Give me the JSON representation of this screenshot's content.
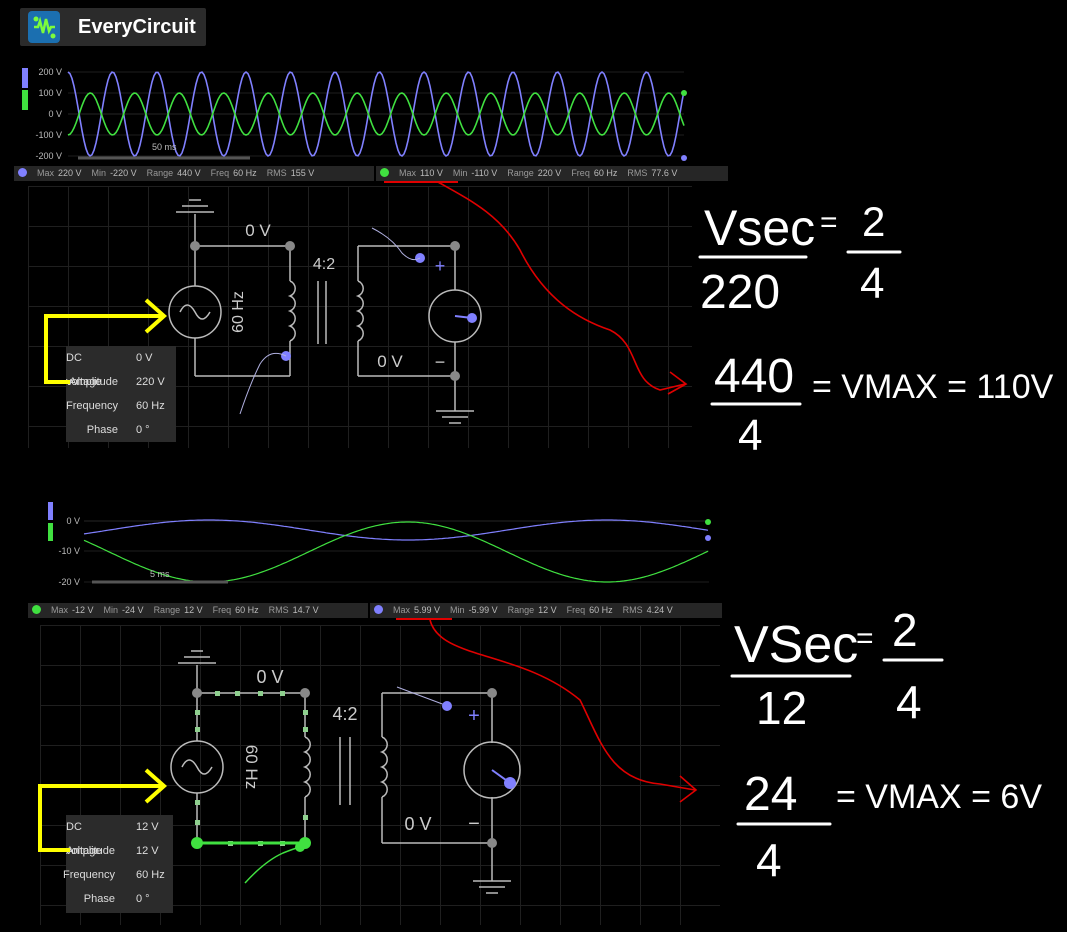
{
  "app": {
    "title": "EveryCircuit"
  },
  "colors": {
    "series_a": "#8080ff",
    "series_b": "#40e040",
    "annotation_red": "#e00000",
    "annotation_yellow": "#ffff00",
    "handwriting": "#ffffff"
  },
  "scope1": {
    "ticks": [
      "200 V",
      "100 V",
      "0 V",
      "-100 V",
      "-200 V"
    ],
    "timescale": "50 ms",
    "stats_a": {
      "max_label": "Max",
      "max": "220 V",
      "min_label": "Min",
      "min": "-220 V",
      "range_label": "Range",
      "range": "440 V",
      "freq_label": "Freq",
      "freq": "60 Hz",
      "rms_label": "RMS",
      "rms": "155 V"
    },
    "stats_b": {
      "max_label": "Max",
      "max": "110 V",
      "min_label": "Min",
      "min": "-110 V",
      "range_label": "Range",
      "range": "220 V",
      "freq_label": "Freq",
      "freq": "60 Hz",
      "rms_label": "RMS",
      "rms": "77.6 V"
    }
  },
  "circuit1": {
    "node_top": "0 V",
    "node_bottom": "0 V",
    "ratio": "4:2",
    "source_freq": "60 Hz",
    "plus": "+",
    "minus": "−",
    "params": [
      {
        "key": "DC voltage",
        "value": "0 V"
      },
      {
        "key": "Amplitude",
        "value": "220 V"
      },
      {
        "key": "Frequency",
        "value": "60 Hz"
      },
      {
        "key": "Phase",
        "value": "0 °"
      }
    ]
  },
  "scope2": {
    "ticks": [
      "0 V",
      "-10 V",
      "-20 V"
    ],
    "timescale": "5 ms",
    "stats_a": {
      "max_label": "Max",
      "max": "-12 V",
      "min_label": "Min",
      "min": "-24 V",
      "range_label": "Range",
      "range": "12 V",
      "freq_label": "Freq",
      "freq": "60 Hz",
      "rms_label": "RMS",
      "rms": "14.7 V"
    },
    "stats_b": {
      "max_label": "Max",
      "max": "5.99 V",
      "min_label": "Min",
      "min": "-5.99 V",
      "range_label": "Range",
      "range": "12 V",
      "freq_label": "Freq",
      "freq": "60 Hz",
      "rms_label": "RMS",
      "rms": "4.24 V"
    }
  },
  "circuit2": {
    "node_top": "0 V",
    "node_bottom": "0 V",
    "ratio": "4:2",
    "source_freq": "60 Hz",
    "plus": "+",
    "minus": "−",
    "params": [
      {
        "key": "DC voltage",
        "value": "12 V"
      },
      {
        "key": "Amplitude",
        "value": "12 V"
      },
      {
        "key": "Frequency",
        "value": "60 Hz"
      },
      {
        "key": "Phase",
        "value": "0 °"
      }
    ]
  },
  "notes": {
    "n1_num": "Vsec",
    "n1_eq": "=",
    "n1_den": "220",
    "n1_rnum": "2",
    "n1_rden": "4",
    "n2_num": "440",
    "n2_den": "4",
    "n2_rest": "= VMAX = 110V",
    "n3_num": "VSec",
    "n3_eq": "=",
    "n3_den": "12",
    "n3_rnum": "2",
    "n3_rden": "4",
    "n4_num": "24",
    "n4_den": "4",
    "n4_rest": "= VMAX = 6V"
  }
}
